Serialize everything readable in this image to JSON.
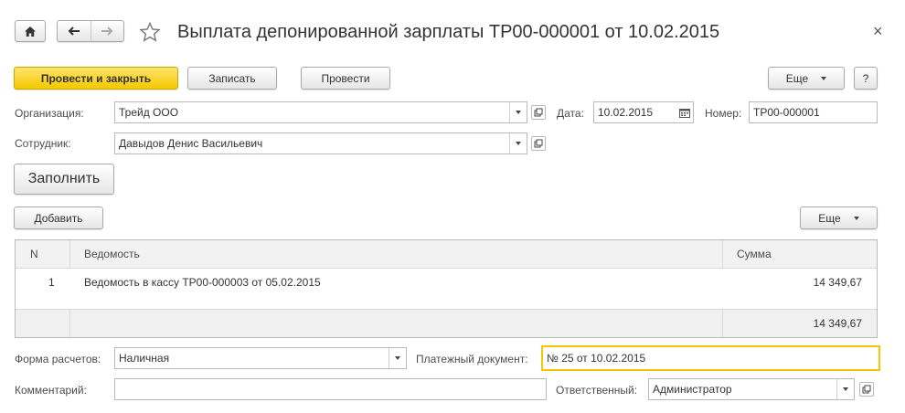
{
  "header": {
    "title": "Выплата депонированной зарплаты ТР00-000001 от 10.02.2015",
    "close_symbol": "×"
  },
  "toolbar": {
    "post_close_label": "Провести и закрыть",
    "save_label": "Записать",
    "post_label": "Провести",
    "more_label": "Еще",
    "help_label": "?"
  },
  "form": {
    "organization_label": "Организация:",
    "organization_value": "Трейд ООО",
    "date_label": "Дата:",
    "date_value": "10.02.2015",
    "number_label": "Номер:",
    "number_value": "ТР00-000001",
    "employee_label": "Сотрудник:",
    "employee_value": "Давыдов Денис Васильевич",
    "fill_label": "Заполнить"
  },
  "table_toolbar": {
    "add_label": "Добавить",
    "more_label": "Еще"
  },
  "table": {
    "columns": [
      "N",
      "Ведомость",
      "Сумма"
    ],
    "rows": [
      {
        "n": "1",
        "statement": "Ведомость в кассу ТР00-000003 от 05.02.2015",
        "amount": "14 349,67"
      }
    ],
    "total": "14 349,67"
  },
  "bottom": {
    "payment_form_label": "Форма расчетов:",
    "payment_form_value": "Наличная",
    "payment_doc_label": "Платежный документ:",
    "payment_doc_value": "№ 25 от 10.02.2015",
    "comment_label": "Комментарий:",
    "comment_value": "",
    "responsible_label": "Ответственный:",
    "responsible_value": "Администратор"
  },
  "colors": {
    "primary_button": "#f5c800",
    "focus_border": "#f2c600"
  }
}
